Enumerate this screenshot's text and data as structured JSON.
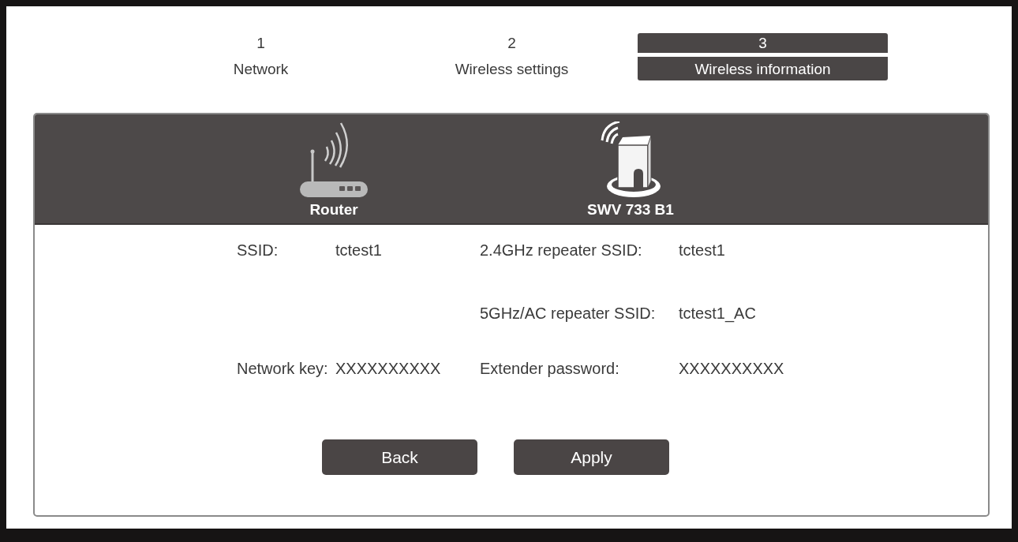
{
  "steps": [
    {
      "number": "1",
      "label": "Network",
      "selected": false
    },
    {
      "number": "2",
      "label": "Wireless settings",
      "selected": false
    },
    {
      "number": "3",
      "label": "Wireless information",
      "selected": true
    }
  ],
  "devices": [
    {
      "kind": "router",
      "label": "Router"
    },
    {
      "kind": "extender",
      "label": "SWV 733 B1"
    }
  ],
  "rows": [
    {
      "router": {
        "label": "SSID:",
        "value": "tctest1"
      },
      "extender": {
        "label": "2.4GHz repeater SSID:",
        "value": "tctest1"
      }
    },
    {
      "extender": {
        "label": "5GHz/AC repeater SSID:",
        "value": "tctest1_AC"
      }
    },
    {
      "router": {
        "label": "Network key:",
        "value": "XXXXXXXXXX"
      },
      "extender": {
        "label": "Extender password:",
        "value": "XXXXXXXXXX"
      }
    }
  ],
  "buttons": [
    {
      "label": "Back"
    },
    {
      "label": "Apply"
    }
  ]
}
